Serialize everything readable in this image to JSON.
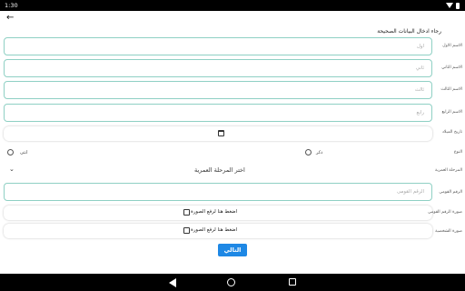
{
  "status_bar": {
    "time": "1:30"
  },
  "form": {
    "title": "رجاء ادخال البيانات الصحيحة",
    "names": [
      {
        "label": "الاسم الاول",
        "placeholder": "اول"
      },
      {
        "label": "الاسم الثاني",
        "placeholder": "ثاني"
      },
      {
        "label": "الاسم الثالث",
        "placeholder": "ثالث"
      },
      {
        "label": "الاسم الرابع",
        "placeholder": "رابع"
      }
    ],
    "birthdate_label": "تاريخ الميلاد",
    "gender": {
      "label": "النوع",
      "male": "ذكر",
      "female": "انثى"
    },
    "stage": {
      "label": "المرحلة العمرية",
      "placeholder": "اختر المرحلة العمرية"
    },
    "national_id": {
      "label": "الرقم القومى",
      "placeholder": "الرقم القومى"
    },
    "id_image": {
      "label": "صورة الرقم القومى",
      "button": "اضغط هنا لرفع الصورة"
    },
    "personal_image": {
      "label": "صورة الشخصية",
      "button": "اضغط هنا لرفع الصورة"
    },
    "next_label": "التالي"
  },
  "colors": {
    "field_border": "#8fd0c4",
    "primary_button": "#1e88e5"
  },
  "icons": [
    "back-arrow-icon",
    "calendar-icon",
    "chevron-down-icon",
    "image-upload-icon",
    "wifi-icon",
    "battery-icon",
    "nav-back-icon",
    "nav-home-icon",
    "nav-recents-icon"
  ]
}
